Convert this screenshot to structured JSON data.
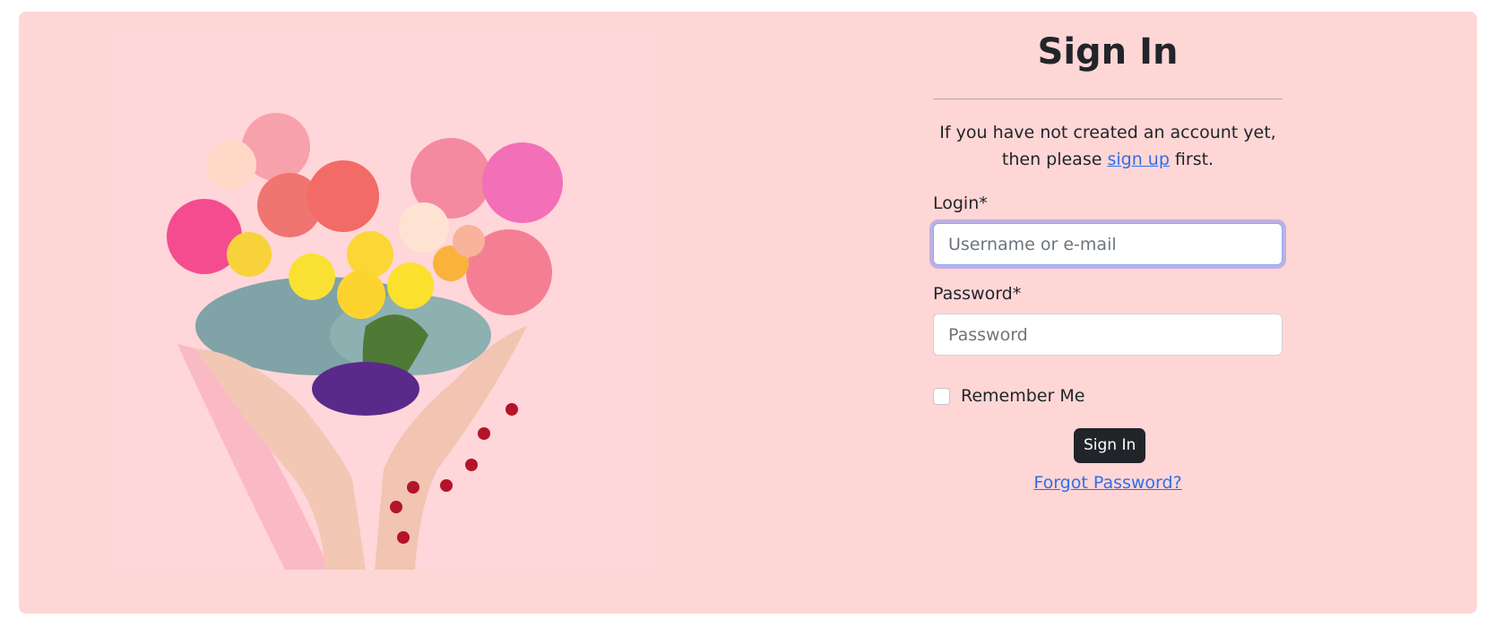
{
  "photo": {
    "alt": "Hands holding a heart-shaped bouquet of flowers"
  },
  "form": {
    "title": "Sign In",
    "intro_before": "If you have not created an account yet,",
    "intro_then": "then please ",
    "signup_link": "sign up",
    "intro_after": " first.",
    "login_label": "Login*",
    "login_placeholder": "Username or e-mail",
    "password_label": "Password*",
    "password_placeholder": "Password",
    "remember_label": "Remember Me",
    "submit_label": "Sign In",
    "forgot_link": "Forgot Password?"
  },
  "colors": {
    "card_bg": "#ffd6d6",
    "button_bg": "#212529",
    "link": "#2f6fe8",
    "focus_ring": "#8fa8f5"
  }
}
